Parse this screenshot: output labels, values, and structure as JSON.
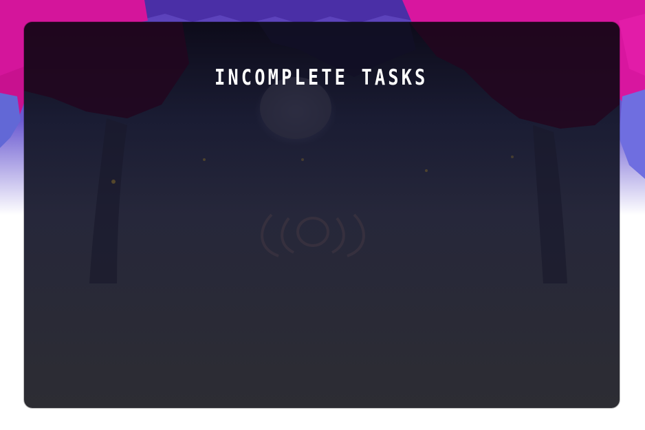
{
  "screen": {
    "title": "INCOMPLETE TASKS"
  },
  "colors": {
    "panel_top": "#0f0d1c",
    "panel_bottom": "#2d2d33",
    "magenta": "#d2179a",
    "purple": "#5b3cb7",
    "title": "#ffffff"
  },
  "icons": {
    "emblem": "antler-emblem-icon"
  }
}
